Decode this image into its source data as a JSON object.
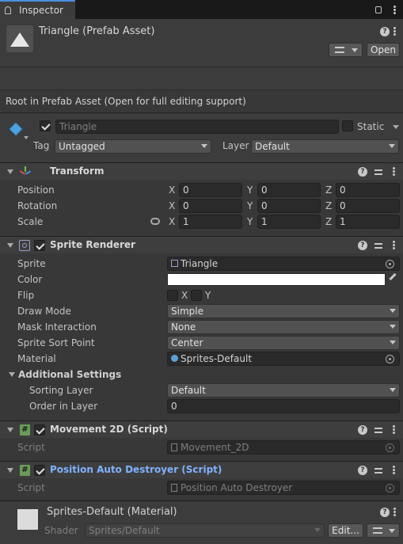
{
  "tab": {
    "label": "Inspector"
  },
  "header": {
    "title": "Triangle (Prefab Asset)",
    "open_label": "Open"
  },
  "notice": "Root in Prefab Asset (Open for full editing support)",
  "gameobject": {
    "name": "Triangle",
    "static_label": "Static",
    "tag_label": "Tag",
    "tag_value": "Untagged",
    "layer_label": "Layer",
    "layer_value": "Default"
  },
  "transform": {
    "title": "Transform",
    "rows": [
      {
        "label": "Position",
        "x": "0",
        "y": "0",
        "z": "0"
      },
      {
        "label": "Rotation",
        "x": "0",
        "y": "0",
        "z": "0"
      },
      {
        "label": "Scale",
        "x": "1",
        "y": "1",
        "z": "1"
      }
    ],
    "axis": {
      "x": "X",
      "y": "Y",
      "z": "Z"
    }
  },
  "sprite_renderer": {
    "title": "Sprite Renderer",
    "sprite_label": "Sprite",
    "sprite_value": "Triangle",
    "color_label": "Color",
    "color_value": "#ffffff",
    "flip_label": "Flip",
    "flip_x": "X",
    "flip_y": "Y",
    "draw_mode_label": "Draw Mode",
    "draw_mode_value": "Simple",
    "mask_label": "Mask Interaction",
    "mask_value": "None",
    "sort_point_label": "Sprite Sort Point",
    "sort_point_value": "Center",
    "material_label": "Material",
    "material_value": "Sprites-Default",
    "additional_label": "Additional Settings",
    "sorting_layer_label": "Sorting Layer",
    "sorting_layer_value": "Default",
    "order_label": "Order in Layer",
    "order_value": "0"
  },
  "movement": {
    "title": "Movement 2D (Script)",
    "script_label": "Script",
    "script_value": "Movement_2D"
  },
  "destroyer": {
    "title": "Position Auto Destroyer (Script)",
    "script_label": "Script",
    "script_value": "Position Auto Destroyer",
    "title_color": "#7fb2ff"
  },
  "material": {
    "title": "Sprites-Default (Material)",
    "shader_label": "Shader",
    "shader_value": "Sprites/Default",
    "edit_label": "Edit..."
  }
}
